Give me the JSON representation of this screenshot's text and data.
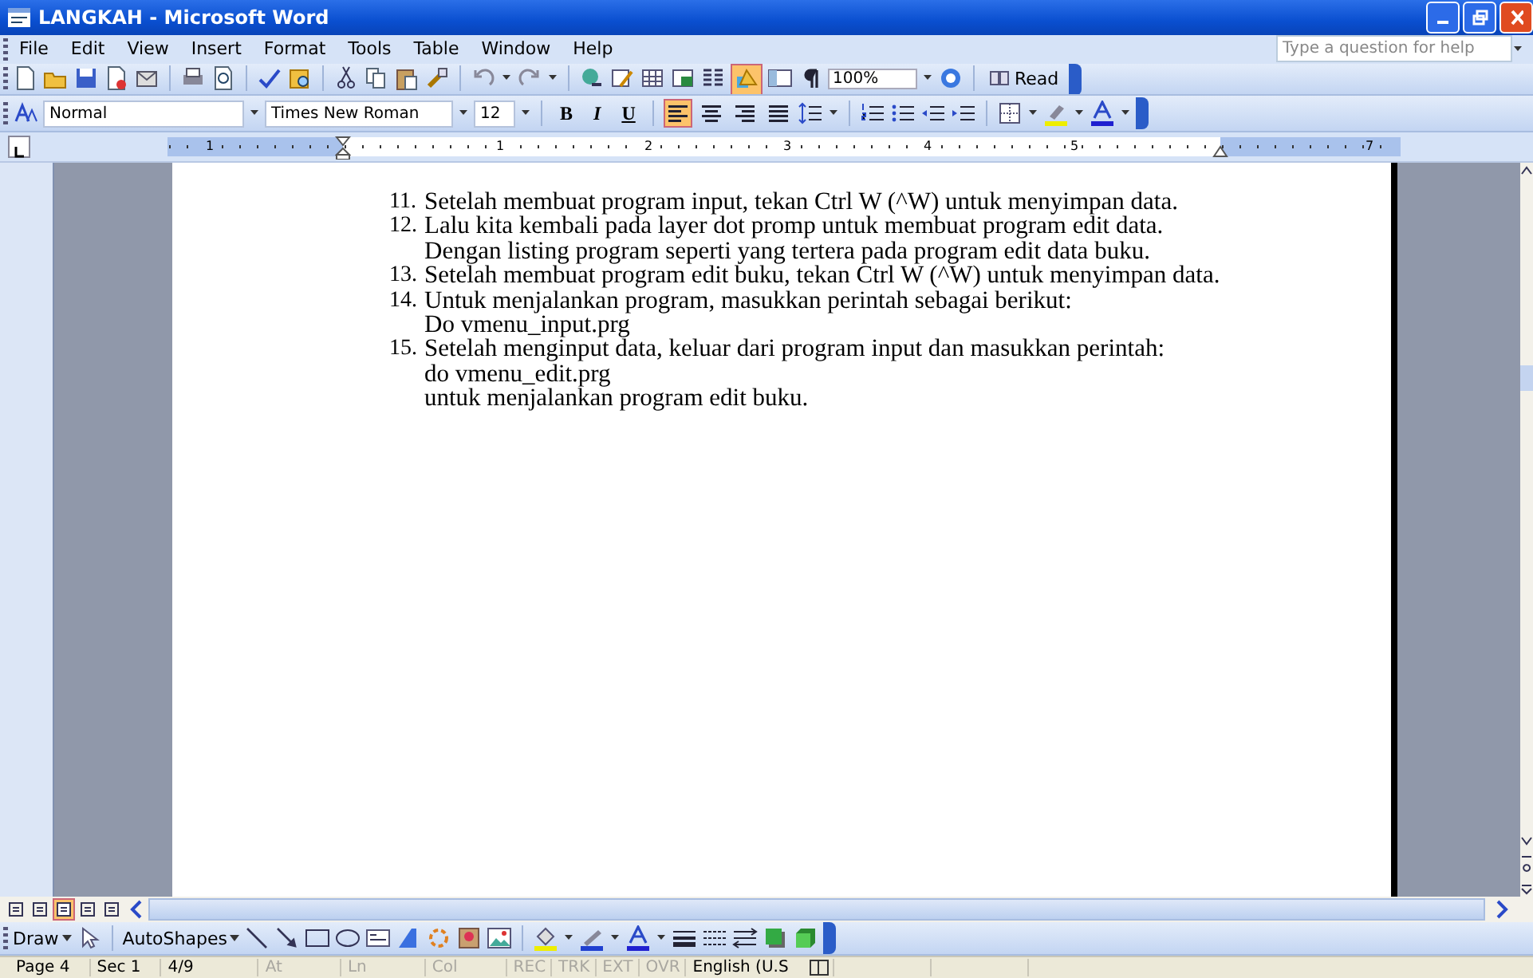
{
  "window": {
    "title": "LANGKAH - Microsoft Word"
  },
  "menu": [
    "File",
    "Edit",
    "View",
    "Insert",
    "Format",
    "Tools",
    "Table",
    "Window",
    "Help"
  ],
  "help_box": {
    "placeholder": "Type a question for help"
  },
  "standard_toolbar": {
    "drawing_pressed": true,
    "zoom": "100%",
    "read": "Read"
  },
  "formatting_toolbar": {
    "style": "Normal",
    "font": "Times New Roman",
    "size": "12",
    "bold": "B",
    "italic": "I",
    "underline": "U",
    "align": [
      {
        "selected": true
      },
      {
        "selected": false
      },
      {
        "selected": false
      },
      {
        "selected": false
      }
    ]
  },
  "ruler": [
    "1",
    "1",
    "2",
    "3",
    "4",
    "5",
    "7"
  ],
  "document": {
    "items": [
      {
        "number": "11.",
        "lines": [
          "Setelah membuat program input, tekan Ctrl W (^W) untuk menyimpan data."
        ]
      },
      {
        "number": "12.",
        "lines": [
          "Lalu kita kembali pada layer dot promp untuk membuat program edit data.",
          "Dengan listing program seperti yang tertera pada program edit data buku."
        ]
      },
      {
        "number": "13.",
        "lines": [
          "Setelah membuat program edit buku, tekan Ctrl W (^W) untuk menyimpan data."
        ]
      },
      {
        "number": "14.",
        "lines": [
          "Untuk menjalankan program, masukkan perintah sebagai berikut:",
          "Do vmenu_input.prg"
        ]
      },
      {
        "number": "15.",
        "lines": [
          "Setelah menginput data, keluar dari program input dan masukkan perintah:",
          "do vmenu_edit.prg",
          "untuk menjalankan program edit buku."
        ]
      }
    ]
  },
  "view_buttons": [
    {
      "selected": false
    },
    {
      "selected": false
    },
    {
      "selected": true
    },
    {
      "selected": false
    },
    {
      "selected": false
    }
  ],
  "drawing_toolbar": {
    "draw": "Draw",
    "autoshapes": "AutoShapes"
  },
  "status_bar": [
    {
      "text": "Page 4",
      "disabled": false
    },
    {
      "text": "Sec 1",
      "disabled": false
    },
    {
      "text": "4/9",
      "disabled": false
    },
    {
      "text": "At",
      "disabled": true
    },
    {
      "text": "Ln",
      "disabled": true
    },
    {
      "text": "Col",
      "disabled": true
    },
    {
      "text": "REC",
      "disabled": true
    },
    {
      "text": "TRK",
      "disabled": true
    },
    {
      "text": "EXT",
      "disabled": true
    },
    {
      "text": "OVR",
      "disabled": true
    },
    {
      "text": "English (U.S",
      "disabled": false
    }
  ]
}
